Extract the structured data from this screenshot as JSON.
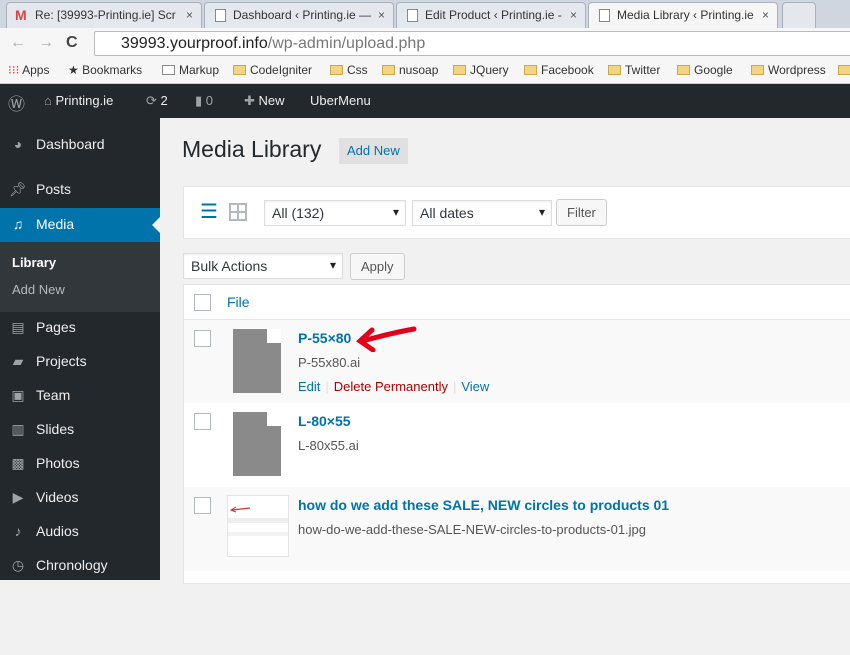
{
  "browser": {
    "tabs": [
      {
        "label": "Re: [39993-Printing.ie] Scr",
        "icon": "gmail-icon"
      },
      {
        "label": "Dashboard ‹ Printing.ie —",
        "icon": "page-icon"
      },
      {
        "label": "Edit Product ‹ Printing.ie -",
        "icon": "page-icon"
      },
      {
        "label": "Media Library ‹ Printing.ie",
        "icon": "page-icon",
        "active": true
      }
    ],
    "url_host": "39993.yourproof.info",
    "url_path": "/wp-admin/upload.php",
    "bookmarks": [
      "Apps",
      "Bookmarks",
      "Markup",
      "CodeIgniter",
      "Css",
      "nusoap",
      "JQuery",
      "Facebook",
      "Twitter",
      "Google",
      "Wordpress"
    ]
  },
  "adminbar": {
    "site": "Printing.ie",
    "updates": "2",
    "comments": "0",
    "new": "New",
    "ubermenu": "UberMenu"
  },
  "sidebar": {
    "items": [
      {
        "label": "Dashboard",
        "icon": "dashboard-icon"
      },
      {
        "label": "Posts",
        "icon": "pin-icon"
      },
      {
        "label": "Media",
        "icon": "media-icon",
        "active": true
      },
      {
        "label": "Pages",
        "icon": "pages-icon"
      },
      {
        "label": "Projects",
        "icon": "projects-icon"
      },
      {
        "label": "Team",
        "icon": "team-icon"
      },
      {
        "label": "Slides",
        "icon": "slides-icon"
      },
      {
        "label": "Photos",
        "icon": "photos-icon"
      },
      {
        "label": "Videos",
        "icon": "videos-icon"
      },
      {
        "label": "Audios",
        "icon": "audios-icon"
      },
      {
        "label": "Chronology",
        "icon": "clock-icon"
      }
    ],
    "submenu": [
      "Library",
      "Add New"
    ]
  },
  "main": {
    "title": "Media Library",
    "add_new": "Add New",
    "filter_type": "All (132)",
    "filter_date": "All dates",
    "filter_button": "Filter",
    "bulk_actions": "Bulk Actions",
    "apply": "Apply",
    "column_file": "File",
    "rows": [
      {
        "title": "P-55×80",
        "file": "P-55x80.ai",
        "actions": [
          "Edit",
          "Delete Permanently",
          "View"
        ]
      },
      {
        "title": "L-80×55",
        "file": "L-80x55.ai"
      },
      {
        "title": "how do we add these SALE, NEW circles to products 01",
        "file": "how-do-we-add-these-SALE-NEW-circles-to-products-01.jpg"
      }
    ]
  },
  "colors": {
    "accent": "#0073aa",
    "sidebar": "#23282d",
    "delete": "#aa0000",
    "annotation": "#e3001b"
  }
}
